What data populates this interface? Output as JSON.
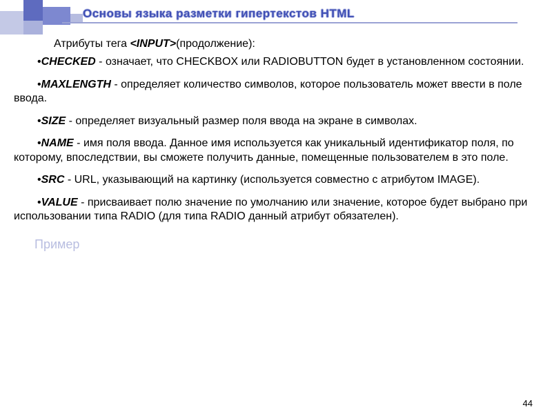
{
  "title": "Основы языка разметки гипертекстов HTML",
  "intro": {
    "prefix": "Атрибуты тега ",
    "tag": "<INPUT>",
    "suffix": "(продолжение):"
  },
  "attrs": [
    {
      "name": "CHECKED",
      "sep": " - ",
      "desc": "означает, что CHECKBOX или RADIOBUTTON будет в установленном состоянии."
    },
    {
      "name": "MAXLENGTH",
      "sep": " - ",
      "desc": "определяет количество символов, которое пользователь может ввести в поле ввода."
    },
    {
      "name": "SIZE",
      "sep": " - ",
      "desc": "определяет визуальный размер поля ввода на экране в символах."
    },
    {
      "name": "NAME",
      "sep": " - ",
      "desc": "имя поля ввода. Данное имя используется как уникальный идентификатор поля, по которому, впоследствии, вы сможете получить данные, помещенные пользователем в это поле."
    },
    {
      "name": "SRC",
      "sep": " - ",
      "desc": "URL, указывающий на картинку (используется совместно с атрибутом IMAGE)."
    },
    {
      "name": "VALUE",
      "sep": " - ",
      "desc": "присваивает полю значение по умолчанию или значение, которое будет выбрано при использовании типа RADIO (для типа RADIO данный атрибут обязателен)."
    }
  ],
  "example_label": "Пример",
  "page_number": "44"
}
